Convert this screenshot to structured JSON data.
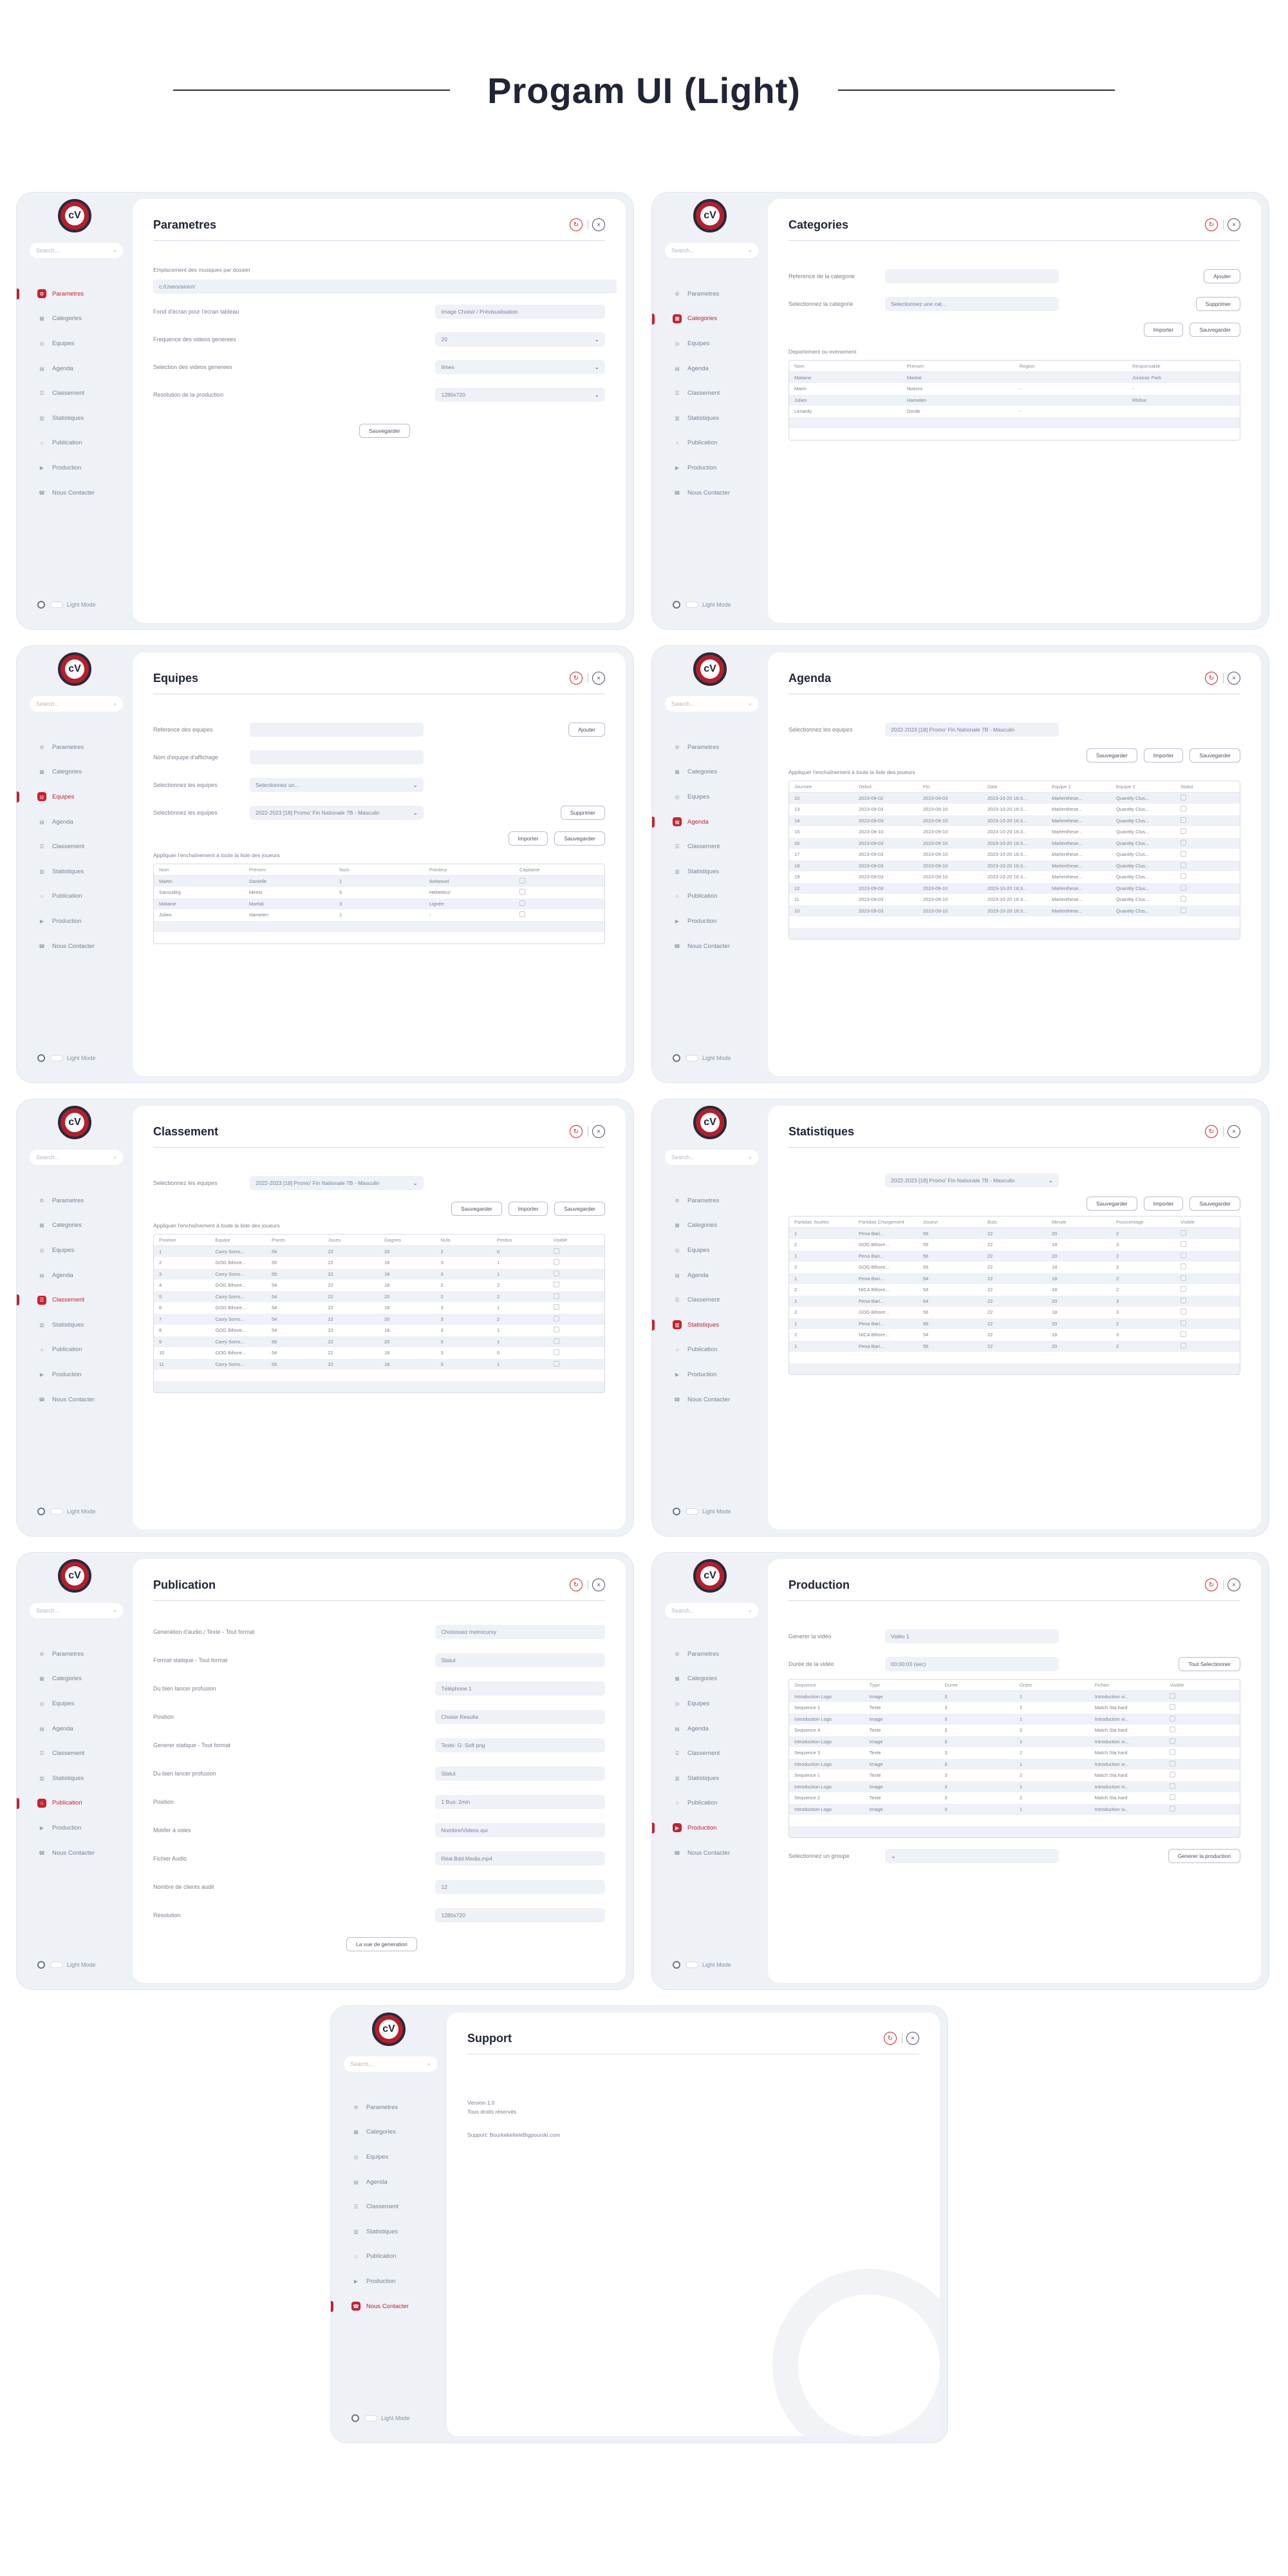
{
  "headline": "Progam UI (Light)",
  "nav": [
    "Parametres",
    "Categories",
    "Equipes",
    "Agenda",
    "Classement",
    "Statistiques",
    "Publication",
    "Production",
    "Nous Contacter"
  ],
  "search_placeholder": "Search...",
  "theme_label": "Light Mode",
  "logo_text": "cV",
  "param": {
    "title": "Parametres",
    "label1": "Emplacement des musiques par dossier",
    "path": "c:/Users/aioin\\/",
    "label2": "Fond d'écran pour l'ecran tableau",
    "bgval": "Image Choisir / Prévisualisation",
    "label3": "Frequence des videos generees",
    "freq": "20",
    "label4": "Selection des videos generees",
    "vsel": "Ilmes",
    "label5": "Resolution de la production",
    "res": "1280x720",
    "save": "Sauvegarder"
  },
  "cat": {
    "title": "Categories",
    "lbl1": "Reference de la categorie",
    "lbl2": "Selectionnez la categorie",
    "sel": "Selectionnez une cat...",
    "add": "Ajouter",
    "del": "Supprimer",
    "sub": "Departement ou evenement",
    "imp": "Importer",
    "sav": "Sauvegarder",
    "cols": [
      "Nom",
      "Prenom",
      "Region",
      "Responsable"
    ],
    "rows": [
      [
        "Malaine",
        "Martial",
        "",
        "Jurassic Park"
      ],
      [
        "Marin",
        "Nuenni",
        "-",
        "-"
      ],
      [
        "Julien",
        "Hamelen",
        "",
        "Rhône"
      ],
      [
        "Lenardy",
        "Dorde",
        "-",
        ""
      ]
    ]
  },
  "equ": {
    "title": "Equipes",
    "lbl1": "Reference des equipes",
    "lbl2": "Nom d'equipe d'affichage",
    "lbl3": "Selectionnez les equipes",
    "lbl4": "Selectionnez les equipes",
    "sel": "Selectionnez un...",
    "sel2": "2022-2023 [18] Promo' Fin Nationale 7B - Masculin",
    "add": "Ajouter",
    "del": "Supprimer",
    "imp": "Importer",
    "sav": "Sauvegarder",
    "sub": "Appliquer l'enchaînement à toute la liste des joueurs",
    "cols": [
      "Nom",
      "Prenom",
      "Num",
      "Pointeur",
      "Capitaine"
    ],
    "rows": [
      [
        "Martin",
        "Danielle",
        "1",
        "Ikebetuel"
      ],
      [
        "Sansudeg",
        "Mireio",
        "5",
        "Hebetteur"
      ],
      [
        "Malaine",
        "Martial",
        "3",
        "Lignée"
      ],
      [
        "Julien",
        "Hamelen",
        "1",
        "-"
      ]
    ]
  },
  "age": {
    "title": "Agenda",
    "lbl": "Selectionnez les equipes",
    "sel": "2022-2023 [18] Promo' Fin Nationale 7B - Masculin",
    "sub": "Appliquer l'enchaînement à toute la liste des joueurs",
    "cols": [
      "Journee",
      "Debut",
      "Fin",
      "Date",
      "Equipe 1",
      "Equipe 2",
      "Statut"
    ],
    "rows": [
      [
        "10",
        "2023-09-02",
        "2023-09-03",
        "2023-10-20 16:3...",
        "Marlenthese...",
        "Quantity Clus..."
      ],
      [
        "13",
        "2023-09-03",
        "2023-09-10",
        "2023-10-20 16:3...",
        "Marlenthese...",
        "Quantity Clus..."
      ],
      [
        "14",
        "2023-09-03",
        "2023-09-10",
        "2023-10-20 16:3...",
        "Marlenthese...",
        "Quantity Clus..."
      ],
      [
        "15",
        "2023-09-10",
        "2023-09-10",
        "2023-10-20 16:3...",
        "Marlenthese...",
        "Quantity Clus..."
      ],
      [
        "16",
        "2023-09-03",
        "2023-09-10",
        "2023-10-20 16:3...",
        "Marlenthese...",
        "Quantity Clus..."
      ],
      [
        "17",
        "2023-09-03",
        "2023-09-10",
        "2023-10-20 16:3...",
        "Marlenthese...",
        "Quantity Clus..."
      ],
      [
        "18",
        "2023-09-03",
        "2023-09-10",
        "2023-10-20 16:3...",
        "Marlenthese...",
        "Quantity Clus..."
      ],
      [
        "19",
        "2023-09-03",
        "2023-09-10",
        "2023-10-20 16:3...",
        "Marlenthese...",
        "Quantity Clus..."
      ],
      [
        "12",
        "2023-09-03",
        "2023-09-10",
        "2023-10-20 16:3...",
        "Marlenthese...",
        "Quantity Clus..."
      ],
      [
        "11",
        "2023-09-03",
        "2023-09-10",
        "2023-10-20 16:3...",
        "Marlenthese...",
        "Quantity Clus..."
      ],
      [
        "10",
        "2023-09-03",
        "2023-09-10",
        "2023-10-20 16:3...",
        "Marlenthese...",
        "Quantity Clus..."
      ]
    ]
  },
  "cla": {
    "title": "Classement",
    "lbl": "Selectionnez les equipes",
    "sel": "2022-2023 [18] Promo' Fin Nationale 7B - Masculin",
    "sub": "Appliquer l'enchaînement à toute la liste des joueurs",
    "cols": [
      "Position",
      "Equipe",
      "Points",
      "Joues",
      "Gagnes",
      "Nuls",
      "Perdus",
      "Visible"
    ],
    "rows": [
      [
        "1",
        "Carry Sorro...",
        "56",
        "22",
        "20",
        "2",
        "0"
      ],
      [
        "2",
        "GOG Bihore...",
        "55",
        "22",
        "18",
        "3",
        "1"
      ],
      [
        "3",
        "Carry Sorro...",
        "55",
        "22",
        "18",
        "3",
        "1"
      ],
      [
        "4",
        "GOG Bihore...",
        "54",
        "22",
        "18",
        "2",
        "2"
      ],
      [
        "5",
        "Carry Sorro...",
        "54",
        "22",
        "20",
        "2",
        "2"
      ],
      [
        "6",
        "GOG Bihore...",
        "54",
        "22",
        "18",
        "3",
        "1"
      ],
      [
        "7",
        "Carry Sorro...",
        "54",
        "22",
        "20",
        "3",
        "2"
      ],
      [
        "8",
        "GOG Bihore...",
        "54",
        "22",
        "18",
        "3",
        "1"
      ],
      [
        "9",
        "Carry Sorro...",
        "56",
        "22",
        "20",
        "3",
        "1"
      ],
      [
        "10",
        "GOG Bihore...",
        "54",
        "22",
        "18",
        "3",
        "0"
      ],
      [
        "11",
        "Carry Sorro...",
        "55",
        "22",
        "18",
        "3",
        "1"
      ]
    ]
  },
  "sta": {
    "title": "Statistiques",
    "sel": "2022-2023 [18] Promo' Fin Nationale 7B - Masculin",
    "cols": [
      "Partidas Jouées",
      "Partidas Chargement",
      "Joueur",
      "Buts",
      "Minute",
      "Pourcentage",
      "Visible"
    ],
    "rows": [
      [
        "1",
        "Pena Bari...",
        "56",
        "22",
        "20",
        "2"
      ],
      [
        "2",
        "GOG Bihore...",
        "55",
        "22",
        "18",
        "3"
      ],
      [
        "1",
        "Pena Bari...",
        "56",
        "22",
        "20",
        "2"
      ],
      [
        "2",
        "GOG Bihore...",
        "55",
        "22",
        "18",
        "3"
      ],
      [
        "1",
        "Pena Bari...",
        "54",
        "22",
        "18",
        "2"
      ],
      [
        "2",
        "NICA Bihore...",
        "54",
        "22",
        "18",
        "2"
      ],
      [
        "1",
        "Pena Bari...",
        "54",
        "22",
        "20",
        "3"
      ],
      [
        "2",
        "GOG Bihore...",
        "56",
        "22",
        "18",
        "3"
      ],
      [
        "1",
        "Pena Bari...",
        "56",
        "22",
        "20",
        "2"
      ],
      [
        "2",
        "NICA Bihore...",
        "54",
        "22",
        "18",
        "3"
      ],
      [
        "1",
        "Pena Bari...",
        "55",
        "22",
        "20",
        "2"
      ]
    ]
  },
  "pub": {
    "title": "Publication",
    "gen": "La vue de generation",
    "rows": [
      [
        "Generation d'audio / Texte - Tout format",
        "Choisissez metrocursy"
      ],
      [
        "Format statique - Tout format",
        "Statut"
      ],
      [
        "Du bien lancer profusion",
        "Téléphone 1"
      ],
      [
        "Position",
        "Choisir Resulta"
      ],
      [
        "Generer statique - Tout format",
        "Texte: G: Soft png"
      ],
      [
        "Du bien lancer profusion",
        "Statut"
      ],
      [
        "Position",
        "1 Bus: 2min"
      ],
      [
        "Motifer à voies",
        "Nombre/Videos qui"
      ],
      [
        "Fichier Audio",
        "Réal.Bdd.Media.mp4"
      ],
      [
        "Nombre de clients audit",
        "12"
      ],
      [
        "Résolution",
        "1280x720"
      ]
    ]
  },
  "pro": {
    "title": "Production",
    "lbl1": "Generer la vidéo",
    "v1": "Vidéo 1",
    "lbl2": "Durée de la vidéo",
    "v2": "00:00:03 (sec)",
    "all": "Tout Selectionner",
    "cols": [
      "Sequence",
      "Type",
      "Duree",
      "Ordre",
      "Fichier",
      "Visible"
    ],
    "rows": [
      [
        "Introduction Logo",
        "Image",
        "3",
        "1",
        "Introduction vi..."
      ],
      [
        "Sequence 1",
        "Texte",
        "3",
        "2",
        "Match Sta.hard"
      ],
      [
        "Introduction Logo",
        "Image",
        "3",
        "1",
        "Introduction vi..."
      ],
      [
        "Sequence 4",
        "Texte",
        "3",
        "2",
        "Match Sta.hard"
      ],
      [
        "Introduction Logo",
        "Image",
        "3",
        "1",
        "Introduction vi..."
      ],
      [
        "Sequence 3",
        "Texte",
        "3",
        "2",
        "Match Sta.hard"
      ],
      [
        "Introduction Logo",
        "Image",
        "3",
        "1",
        "Introduction vi..."
      ],
      [
        "Sequence 1",
        "Texte",
        "3",
        "2",
        "Match Sta.hard"
      ],
      [
        "Introduction Logo",
        "Image",
        "3",
        "1",
        "Introduction vi..."
      ],
      [
        "Sequence 2",
        "Texte",
        "3",
        "2",
        "Match Sta.hard"
      ],
      [
        "Introduction Logo",
        "Image",
        "3",
        "1",
        "Introduction vi..."
      ]
    ],
    "lbl3": "Selectionnez un groupe",
    "gen": "Generer la production"
  },
  "sup": {
    "title": "Support",
    "version": "Version 1.0",
    "rights": "Tous droits réservés",
    "email": "Support: BourkekelteleBigpourski.com"
  }
}
